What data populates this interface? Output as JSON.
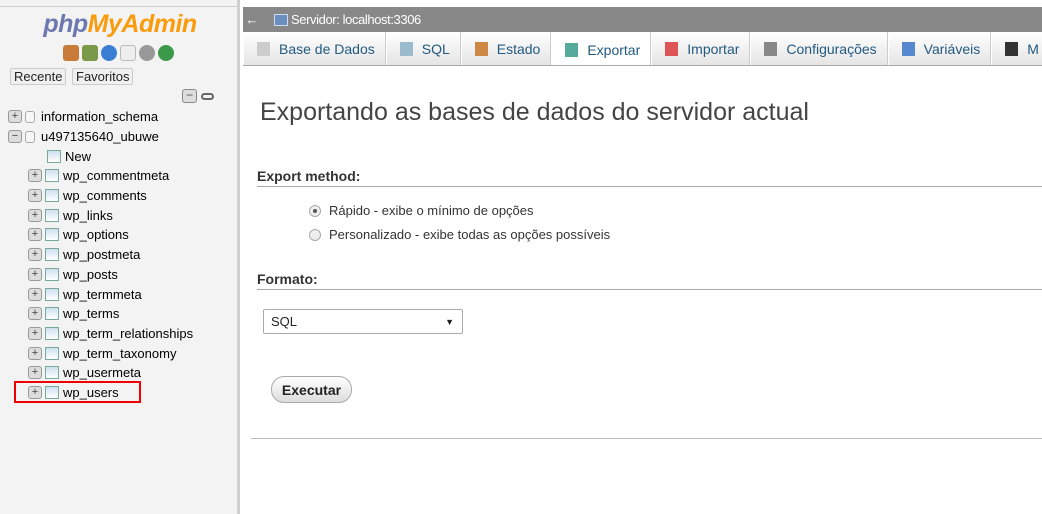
{
  "sidebar": {
    "logo_php": "php",
    "logo_myadmin": "MyAdmin",
    "icons": [
      "home-icon",
      "logout-icon",
      "help-icon",
      "docs-icon",
      "settings-icon",
      "reload-icon"
    ],
    "recent": "Recente",
    "favorites": "Favoritos",
    "databases": [
      {
        "name": "information_schema",
        "expanded": false
      },
      {
        "name": "u497135640_ubuwe",
        "expanded": true
      }
    ],
    "new_label": "New",
    "tables": [
      "wp_commentmeta",
      "wp_comments",
      "wp_links",
      "wp_options",
      "wp_postmeta",
      "wp_posts",
      "wp_termmeta",
      "wp_terms",
      "wp_term_relationships",
      "wp_term_taxonomy",
      "wp_usermeta",
      "wp_users"
    ],
    "highlighted": "wp_users",
    "highlight_color": "#e00000"
  },
  "topbar": {
    "back": "←",
    "server": "Servidor: localhost:3306"
  },
  "tabs": [
    {
      "label": "Base de Dados",
      "icon": "database-icon"
    },
    {
      "label": "SQL",
      "icon": "sql-icon"
    },
    {
      "label": "Estado",
      "icon": "status-icon"
    },
    {
      "label": "Exportar",
      "icon": "export-icon",
      "active": true
    },
    {
      "label": "Importar",
      "icon": "import-icon"
    },
    {
      "label": "Configurações",
      "icon": "wrench-icon"
    },
    {
      "label": "Variáveis",
      "icon": "variables-icon"
    },
    {
      "label": "M",
      "icon": "menu-icon"
    }
  ],
  "main": {
    "title": "Exportando as bases de dados do servidor actual",
    "export_method": "Export method:",
    "options": [
      {
        "label": "Rápido - exibe o mínimo de opções",
        "checked": true
      },
      {
        "label": "Personalizado - exibe todas as opções possíveis",
        "checked": false
      }
    ],
    "format_label": "Formato:",
    "format_value": "SQL",
    "execute": "Executar"
  }
}
